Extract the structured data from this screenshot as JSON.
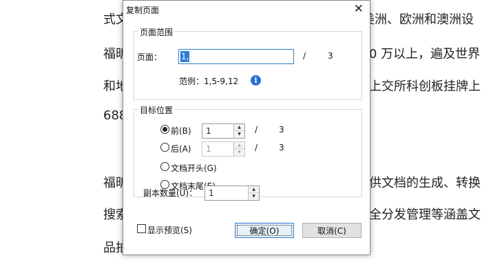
{
  "document": {
    "lines_left": [
      "式文",
      "福昕",
      "和地",
      "688",
      "福昕",
      "搜索",
      "品拍"
    ],
    "lines_right": [
      "美洲、欧洲和澳洲设",
      "0 万以上，遍及世界",
      "上交所科创板挂牌上",
      "",
      "供文档的生成、转换",
      "全分发管理等涵盖文",
      ""
    ]
  },
  "dialog": {
    "title": "复制页面",
    "close_glyph": "✕",
    "page_range": {
      "legend": "页面范围",
      "pages_label": "页面：",
      "pages_value": "1,",
      "slash": "/",
      "total": "3",
      "example_label": "范例：1,5-9,12",
      "info_glyph": "i"
    },
    "target": {
      "legend": "目标位置",
      "options": [
        {
          "label": "前(B)",
          "checked": true,
          "page": "1",
          "total": "3",
          "enabled": true
        },
        {
          "label": "后(A)",
          "checked": false,
          "page": "1",
          "total": "3",
          "enabled": false
        },
        {
          "label": "文档开头(G)",
          "checked": false
        },
        {
          "label": "文档末尾(E)",
          "checked": false
        }
      ],
      "slash": "/",
      "spin_up": "▲",
      "spin_down": "▼"
    },
    "copies": {
      "label": "副本数量(U)：",
      "value": "1"
    },
    "preview_label": "显示预览(S)",
    "ok_label": "确定(O)",
    "cancel_label": "取消(C)"
  }
}
